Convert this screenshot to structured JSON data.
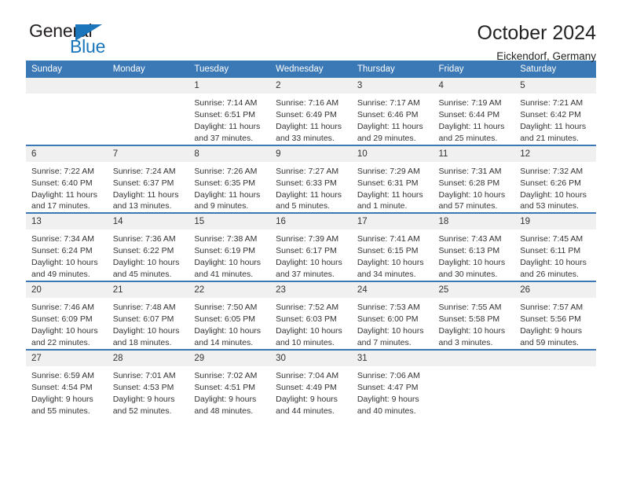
{
  "brand": {
    "name_top": "General",
    "name_bottom": "Blue",
    "color_primary": "#1b75bb",
    "color_text": "#231f20"
  },
  "header": {
    "title": "October 2024",
    "subtitle": "Eickendorf, Germany"
  },
  "theme": {
    "header_band": "#3b78b6",
    "daynum_band": "#f0f0f0",
    "text": "#333333"
  },
  "weekday_headers": [
    "Sunday",
    "Monday",
    "Tuesday",
    "Wednesday",
    "Thursday",
    "Friday",
    "Saturday"
  ],
  "labels": {
    "sunrise_prefix": "Sunrise:",
    "sunset_prefix": "Sunset:",
    "daylight_prefix": "Daylight:"
  },
  "weeks": [
    [
      {
        "day": "",
        "blank": true
      },
      {
        "day": "",
        "blank": true
      },
      {
        "day": "1",
        "sunrise": "Sunrise: 7:14 AM",
        "sunset": "Sunset: 6:51 PM",
        "daylight": "Daylight: 11 hours and 37 minutes."
      },
      {
        "day": "2",
        "sunrise": "Sunrise: 7:16 AM",
        "sunset": "Sunset: 6:49 PM",
        "daylight": "Daylight: 11 hours and 33 minutes."
      },
      {
        "day": "3",
        "sunrise": "Sunrise: 7:17 AM",
        "sunset": "Sunset: 6:46 PM",
        "daylight": "Daylight: 11 hours and 29 minutes."
      },
      {
        "day": "4",
        "sunrise": "Sunrise: 7:19 AM",
        "sunset": "Sunset: 6:44 PM",
        "daylight": "Daylight: 11 hours and 25 minutes."
      },
      {
        "day": "5",
        "sunrise": "Sunrise: 7:21 AM",
        "sunset": "Sunset: 6:42 PM",
        "daylight": "Daylight: 11 hours and 21 minutes."
      }
    ],
    [
      {
        "day": "6",
        "sunrise": "Sunrise: 7:22 AM",
        "sunset": "Sunset: 6:40 PM",
        "daylight": "Daylight: 11 hours and 17 minutes."
      },
      {
        "day": "7",
        "sunrise": "Sunrise: 7:24 AM",
        "sunset": "Sunset: 6:37 PM",
        "daylight": "Daylight: 11 hours and 13 minutes."
      },
      {
        "day": "8",
        "sunrise": "Sunrise: 7:26 AM",
        "sunset": "Sunset: 6:35 PM",
        "daylight": "Daylight: 11 hours and 9 minutes."
      },
      {
        "day": "9",
        "sunrise": "Sunrise: 7:27 AM",
        "sunset": "Sunset: 6:33 PM",
        "daylight": "Daylight: 11 hours and 5 minutes."
      },
      {
        "day": "10",
        "sunrise": "Sunrise: 7:29 AM",
        "sunset": "Sunset: 6:31 PM",
        "daylight": "Daylight: 11 hours and 1 minute."
      },
      {
        "day": "11",
        "sunrise": "Sunrise: 7:31 AM",
        "sunset": "Sunset: 6:28 PM",
        "daylight": "Daylight: 10 hours and 57 minutes."
      },
      {
        "day": "12",
        "sunrise": "Sunrise: 7:32 AM",
        "sunset": "Sunset: 6:26 PM",
        "daylight": "Daylight: 10 hours and 53 minutes."
      }
    ],
    [
      {
        "day": "13",
        "sunrise": "Sunrise: 7:34 AM",
        "sunset": "Sunset: 6:24 PM",
        "daylight": "Daylight: 10 hours and 49 minutes."
      },
      {
        "day": "14",
        "sunrise": "Sunrise: 7:36 AM",
        "sunset": "Sunset: 6:22 PM",
        "daylight": "Daylight: 10 hours and 45 minutes."
      },
      {
        "day": "15",
        "sunrise": "Sunrise: 7:38 AM",
        "sunset": "Sunset: 6:19 PM",
        "daylight": "Daylight: 10 hours and 41 minutes."
      },
      {
        "day": "16",
        "sunrise": "Sunrise: 7:39 AM",
        "sunset": "Sunset: 6:17 PM",
        "daylight": "Daylight: 10 hours and 37 minutes."
      },
      {
        "day": "17",
        "sunrise": "Sunrise: 7:41 AM",
        "sunset": "Sunset: 6:15 PM",
        "daylight": "Daylight: 10 hours and 34 minutes."
      },
      {
        "day": "18",
        "sunrise": "Sunrise: 7:43 AM",
        "sunset": "Sunset: 6:13 PM",
        "daylight": "Daylight: 10 hours and 30 minutes."
      },
      {
        "day": "19",
        "sunrise": "Sunrise: 7:45 AM",
        "sunset": "Sunset: 6:11 PM",
        "daylight": "Daylight: 10 hours and 26 minutes."
      }
    ],
    [
      {
        "day": "20",
        "sunrise": "Sunrise: 7:46 AM",
        "sunset": "Sunset: 6:09 PM",
        "daylight": "Daylight: 10 hours and 22 minutes."
      },
      {
        "day": "21",
        "sunrise": "Sunrise: 7:48 AM",
        "sunset": "Sunset: 6:07 PM",
        "daylight": "Daylight: 10 hours and 18 minutes."
      },
      {
        "day": "22",
        "sunrise": "Sunrise: 7:50 AM",
        "sunset": "Sunset: 6:05 PM",
        "daylight": "Daylight: 10 hours and 14 minutes."
      },
      {
        "day": "23",
        "sunrise": "Sunrise: 7:52 AM",
        "sunset": "Sunset: 6:03 PM",
        "daylight": "Daylight: 10 hours and 10 minutes."
      },
      {
        "day": "24",
        "sunrise": "Sunrise: 7:53 AM",
        "sunset": "Sunset: 6:00 PM",
        "daylight": "Daylight: 10 hours and 7 minutes."
      },
      {
        "day": "25",
        "sunrise": "Sunrise: 7:55 AM",
        "sunset": "Sunset: 5:58 PM",
        "daylight": "Daylight: 10 hours and 3 minutes."
      },
      {
        "day": "26",
        "sunrise": "Sunrise: 7:57 AM",
        "sunset": "Sunset: 5:56 PM",
        "daylight": "Daylight: 9 hours and 59 minutes."
      }
    ],
    [
      {
        "day": "27",
        "sunrise": "Sunrise: 6:59 AM",
        "sunset": "Sunset: 4:54 PM",
        "daylight": "Daylight: 9 hours and 55 minutes."
      },
      {
        "day": "28",
        "sunrise": "Sunrise: 7:01 AM",
        "sunset": "Sunset: 4:53 PM",
        "daylight": "Daylight: 9 hours and 52 minutes."
      },
      {
        "day": "29",
        "sunrise": "Sunrise: 7:02 AM",
        "sunset": "Sunset: 4:51 PM",
        "daylight": "Daylight: 9 hours and 48 minutes."
      },
      {
        "day": "30",
        "sunrise": "Sunrise: 7:04 AM",
        "sunset": "Sunset: 4:49 PM",
        "daylight": "Daylight: 9 hours and 44 minutes."
      },
      {
        "day": "31",
        "sunrise": "Sunrise: 7:06 AM",
        "sunset": "Sunset: 4:47 PM",
        "daylight": "Daylight: 9 hours and 40 minutes."
      },
      {
        "day": "",
        "blank": true
      },
      {
        "day": "",
        "blank": true
      }
    ]
  ]
}
